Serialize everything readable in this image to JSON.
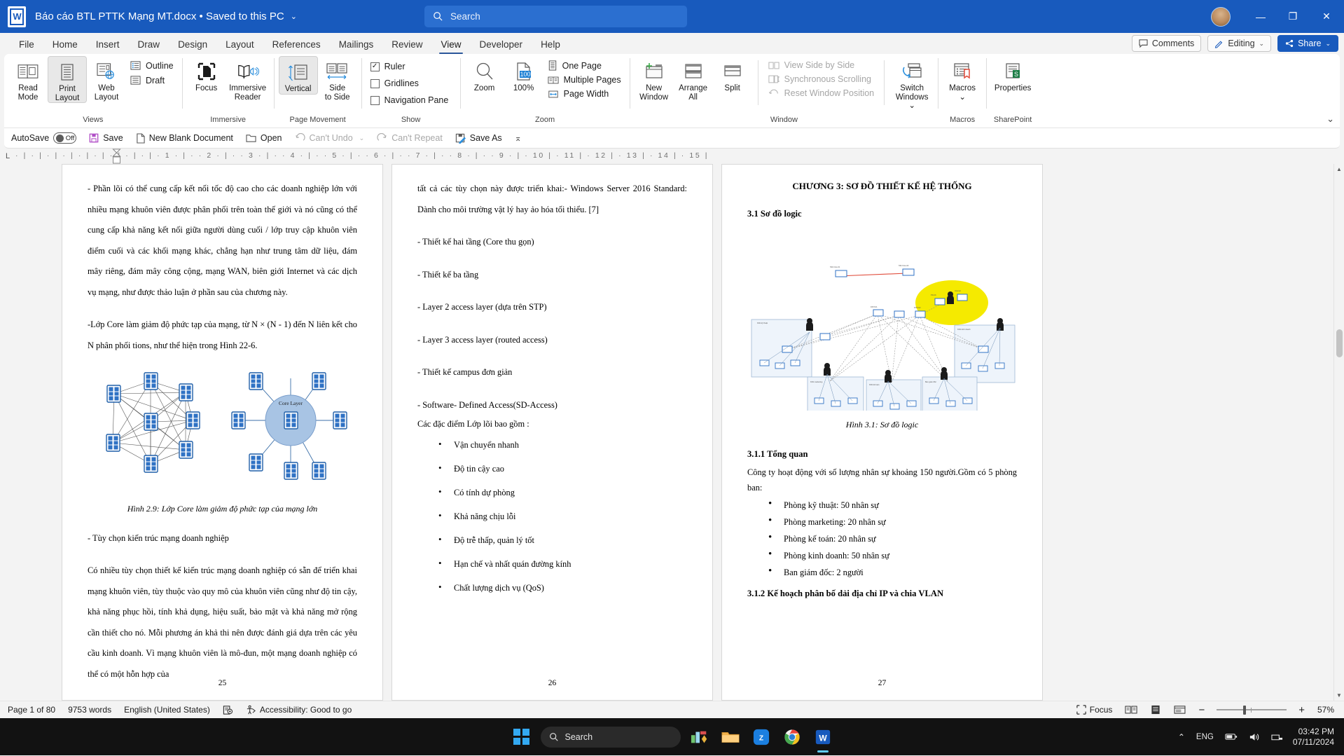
{
  "titlebar": {
    "app_icon": "word-logo-icon",
    "document_title": "Báo cáo BTL PTTK Mạng MT.docx • Saved to this PC",
    "title_chevron": "⌄",
    "search_placeholder": "Search",
    "search_icon": "search-icon",
    "minimize": "—",
    "restore": "❐",
    "close": "✕",
    "accent_color": "#185abd"
  },
  "tabs": [
    {
      "label": "File",
      "active": false
    },
    {
      "label": "Home",
      "active": false
    },
    {
      "label": "Insert",
      "active": false
    },
    {
      "label": "Draw",
      "active": false
    },
    {
      "label": "Design",
      "active": false
    },
    {
      "label": "Layout",
      "active": false
    },
    {
      "label": "References",
      "active": false
    },
    {
      "label": "Mailings",
      "active": false
    },
    {
      "label": "Review",
      "active": false
    },
    {
      "label": "View",
      "active": true
    },
    {
      "label": "Developer",
      "active": false
    },
    {
      "label": "Help",
      "active": false
    }
  ],
  "tab_right": {
    "comments_label": "Comments",
    "editing_label": "Editing",
    "editing_chevron": "⌄",
    "share_label": "Share",
    "share_chevron": "⌄"
  },
  "ribbon": {
    "groups": [
      {
        "name": "views",
        "label": "Views",
        "buttons": [
          {
            "name": "read-mode",
            "label": "Read\nMode",
            "selected": false
          },
          {
            "name": "print-layout",
            "label": "Print\nLayout",
            "selected": true
          },
          {
            "name": "web-layout",
            "label": "Web\nLayout",
            "selected": false
          }
        ],
        "small": [
          {
            "name": "outline",
            "label": "Outline"
          },
          {
            "name": "draft",
            "label": "Draft"
          }
        ]
      },
      {
        "name": "immersive",
        "label": "Immersive",
        "buttons": [
          {
            "name": "focus",
            "label": "Focus",
            "selected": false
          },
          {
            "name": "immersive-reader",
            "label": "Immersive\nReader",
            "selected": false
          }
        ]
      },
      {
        "name": "page-movement",
        "label": "Page Movement",
        "buttons": [
          {
            "name": "vertical",
            "label": "Vertical",
            "selected": true
          },
          {
            "name": "side-to-side",
            "label": "Side\nto Side",
            "selected": false
          }
        ]
      },
      {
        "name": "show",
        "label": "Show",
        "checkboxes": [
          {
            "name": "ruler",
            "label": "Ruler",
            "checked": true
          },
          {
            "name": "gridlines",
            "label": "Gridlines",
            "checked": false
          },
          {
            "name": "navigation-pane",
            "label": "Navigation Pane",
            "checked": false
          }
        ]
      },
      {
        "name": "zoom",
        "label": "Zoom",
        "buttons": [
          {
            "name": "zoom",
            "label": "Zoom",
            "selected": false
          },
          {
            "name": "zoom-100",
            "label": "100%",
            "selected": false,
            "badge": "100"
          }
        ],
        "small": [
          {
            "name": "one-page",
            "label": "One Page"
          },
          {
            "name": "multiple-pages",
            "label": "Multiple Pages"
          },
          {
            "name": "page-width",
            "label": "Page Width"
          }
        ]
      },
      {
        "name": "window",
        "label": "Window",
        "buttons": [
          {
            "name": "new-window",
            "label": "New\nWindow",
            "selected": false
          },
          {
            "name": "arrange-all",
            "label": "Arrange\nAll",
            "selected": false
          },
          {
            "name": "split",
            "label": "Split",
            "selected": false
          }
        ],
        "small": [
          {
            "name": "view-side-by-side",
            "label": "View Side by Side",
            "disabled": true
          },
          {
            "name": "synchronous-scrolling",
            "label": "Synchronous Scrolling",
            "disabled": true
          },
          {
            "name": "reset-window-position",
            "label": "Reset Window Position",
            "disabled": true
          }
        ],
        "buttons2": [
          {
            "name": "switch-windows",
            "label": "Switch\nWindows ⌄",
            "selected": false
          }
        ]
      },
      {
        "name": "macros",
        "label": "Macros",
        "buttons": [
          {
            "name": "macros",
            "label": "Macros\n⌄",
            "selected": false
          }
        ]
      },
      {
        "name": "sharepoint",
        "label": "SharePoint",
        "buttons": [
          {
            "name": "properties",
            "label": "Properties",
            "selected": false
          }
        ]
      }
    ],
    "collapse_chevron": "⌄"
  },
  "quick_access": {
    "autosave_label": "AutoSave",
    "autosave_state": "Off",
    "items": [
      {
        "name": "save",
        "label": "Save",
        "disabled": false,
        "icon": "save-icon"
      },
      {
        "name": "new-blank-document",
        "label": "New Blank Document",
        "disabled": false,
        "icon": "page-icon"
      },
      {
        "name": "open",
        "label": "Open",
        "disabled": false,
        "icon": "folder-icon"
      },
      {
        "name": "cant-undo",
        "label": "Can't Undo",
        "disabled": true,
        "icon": "undo-icon"
      },
      {
        "name": "cant-repeat",
        "label": "Can't Repeat",
        "disabled": true,
        "icon": "repeat-icon"
      },
      {
        "name": "save-as",
        "label": "Save As",
        "disabled": false,
        "icon": "save-as-icon"
      }
    ],
    "undo_chevron": "⌄",
    "more_chevron": "⌅"
  },
  "ruler": {
    "corner_label": "L",
    "ticks": "· | · | · | · | · | · | · | · | · | · 1 · | · · 2 · | · · 3 · | · · 4 · | · · 5 · | · · 6 · | · · 7 · | · · 8 · | · · 9 · | · 10 | · 11 | · 12 | · 13 | · 14 | · 15 |"
  },
  "document": {
    "page1": {
      "number": "25",
      "paragraphs": [
        "- Phần lõi có thể cung cấp kết nối tốc độ cao cho các doanh nghiệp lớn với nhiều mạng khuôn viên được phân phối trên toàn thế giới và nó cũng có thể cung cấp khả năng kết nối giữa người dùng cuối / lớp truy cập khuôn viên điểm cuối và các khối mạng khác, chẳng hạn như trung tâm dữ liệu, đám mây riêng, đám mây công cộng, mạng WAN, biên giới Internet và các dịch vụ mạng, như được thảo luận ở phần sau của chương này.",
        "-Lớp Core làm giảm độ phức tạp của mạng, từ N × (N - 1) đến N liên kết cho N phân phối tions, như thể hiện trong Hình 22-6."
      ],
      "figure_caption": "Hình 2.9: Lớp Core làm giảm độ phức tạp của mạng lớn",
      "figure_label": "Core Layer",
      "paragraphs_after": [
        "- Tùy chọn kiến trúc mạng doanh nghiệp",
        "Có nhiều tùy chọn thiết kế kiến trúc mạng doanh nghiệp có sẵn để triển khai mạng khuôn viên, tùy thuộc vào quy mô của khuôn viên cũng như độ tin cậy, khả năng phục hồi, tính khả dụng, hiệu suất, bảo mật và khả năng mở rộng cần thiết cho nó. Mỗi phương án khả thi nên được đánh giá dựa trên các yêu cầu kinh doanh. Vì mạng khuôn viên là mô-đun, một mạng doanh nghiệp có thể có một hỗn hợp của"
      ]
    },
    "page2": {
      "number": "26",
      "intro": "tất cả các tùy chọn này được triển khai:- Windows Server 2016 Standard: Dành cho môi trường vật lý hay ảo hóa tối thiểu. [7]",
      "list_dashes": [
        "- Thiết kế hai tầng (Core thu gọn)",
        "- Thiết kế ba tầng",
        "- Layer 2 access layer (dựa trên STP)",
        "- Layer 3 access layer (routed access)",
        "- Thiết kế campus đơn giản",
        "- Software- Defined Access(SD-Access)"
      ],
      "list_intro": "Các đặc điểm Lớp lõi bao gồm :",
      "bullets": [
        "Vận chuyển nhanh",
        "Độ tin cậy cao",
        "Có tính dự phòng",
        "Khả năng chịu lỗi",
        "Độ trễ thấp, quản lý tốt",
        "Hạn chế và nhất quán đường kính",
        "Chất lượng dịch vụ (QoS)"
      ]
    },
    "page3": {
      "number": "27",
      "chapter_title": "CHƯƠNG 3: SƠ ĐỒ THIẾT KẾ HỆ THỐNG",
      "section_31": "3.1 Sơ đồ logic",
      "figure_caption": "Hình 3.1: Sơ đồ logic",
      "section_311": "3.1.1 Tổng quan",
      "overview": "Công ty hoạt động với số lượng nhân sự khoảng 150 người.Gồm có 5 phòng ban:",
      "departments": [
        "Phòng kỹ thuật: 50 nhân sự",
        "Phòng marketing: 20 nhân sự",
        "Phòng kế toán: 20 nhân sự",
        "Phòng kinh doanh: 50 nhân sự",
        "Ban giám đốc: 2 người"
      ],
      "section_312": "3.1.2 Kế hoạch phân bố dải địa chỉ IP và chia VLAN"
    }
  },
  "statusbar": {
    "page_info": "Page 1 of 80",
    "word_count": "9753 words",
    "language": "English (United States)",
    "proofing_icon": "proofing-icon",
    "accessibility": "Accessibility: Good to go",
    "focus_label": "Focus",
    "read_mode_icon": "read-mode-icon",
    "print_layout_icon": "print-layout-icon",
    "web_layout_icon": "web-layout-icon",
    "zoom_out": "−",
    "zoom_in": "+",
    "zoom_level": "57%"
  },
  "taskbar": {
    "start_icon": "windows-start-icon",
    "search_placeholder": "Search",
    "apps": [
      {
        "name": "widgets-icon",
        "label": ""
      },
      {
        "name": "file-explorer-icon",
        "label": ""
      },
      {
        "name": "zalo-icon",
        "label": "Zalo"
      },
      {
        "name": "chrome-icon",
        "label": ""
      },
      {
        "name": "word-taskbar-icon",
        "label": "W"
      }
    ],
    "tray_chevron": "⌃",
    "language": "ENG",
    "time": "03:42 PM",
    "date": "07/11/2024"
  }
}
